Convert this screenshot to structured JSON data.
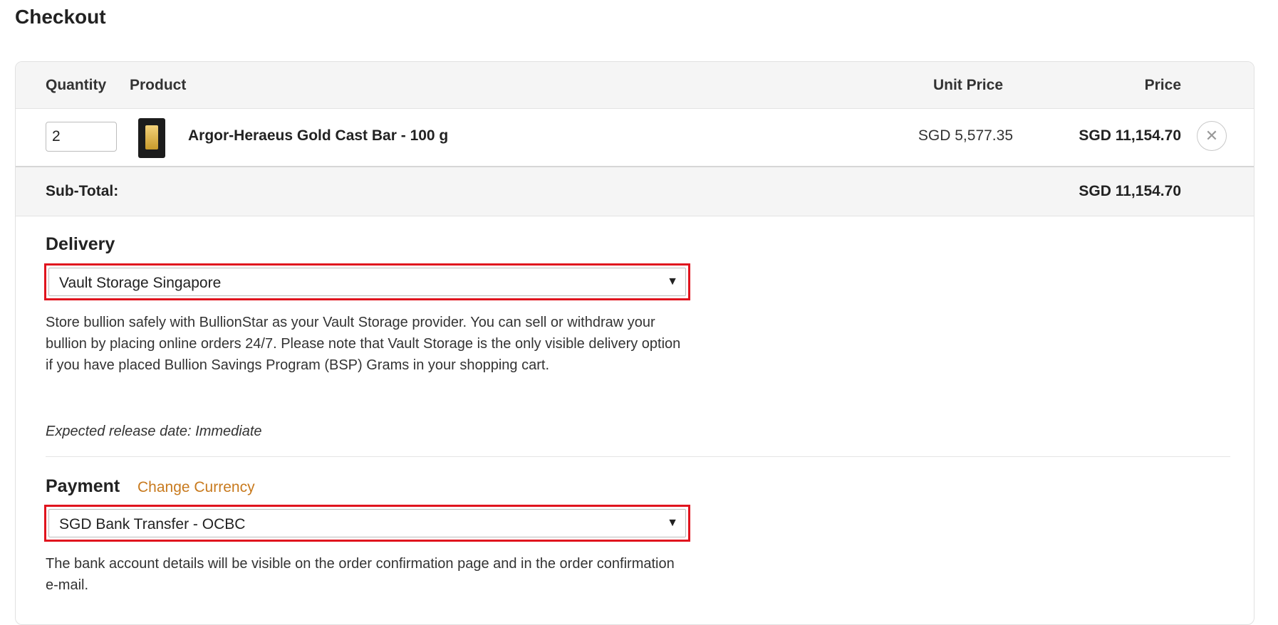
{
  "page": {
    "title": "Checkout"
  },
  "cart": {
    "headers": {
      "quantity": "Quantity",
      "product": "Product",
      "unit_price": "Unit Price",
      "price": "Price"
    },
    "items": [
      {
        "quantity": "2",
        "name": "Argor-Heraeus Gold Cast Bar - 100 g",
        "unit_price": "SGD 5,577.35",
        "price": "SGD 11,154.70",
        "thumb_icon": "gold-bar-icon"
      }
    ],
    "remove_icon": "close-icon",
    "subtotal": {
      "label": "Sub-Total:",
      "value": "SGD 11,154.70"
    }
  },
  "delivery": {
    "title": "Delivery",
    "selected": "Vault Storage Singapore",
    "description": "Store bullion safely with BullionStar as your Vault Storage provider. You can sell or withdraw your bullion by placing online orders 24/7. Please note that Vault Storage is the only visible delivery option if you have placed Bullion Savings Program (BSP) Grams in your shopping cart.",
    "release": "Expected release date: Immediate"
  },
  "payment": {
    "title": "Payment",
    "change_currency": "Change Currency",
    "selected": "SGD Bank Transfer - OCBC",
    "description": "The bank account details will be visible on the order confirmation page and in the order confirmation e-mail."
  },
  "colors": {
    "highlight": "#e0141e",
    "link": "#c87a1e",
    "header_bg": "#f5f5f5"
  }
}
